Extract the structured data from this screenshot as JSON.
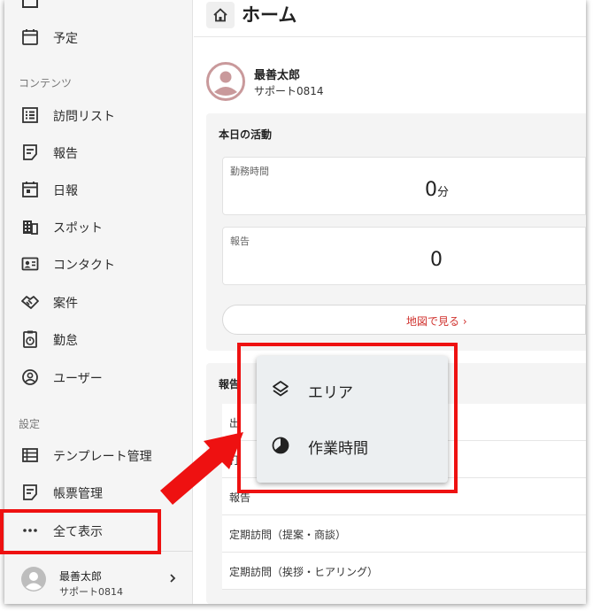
{
  "sidebar": {
    "items_top": [
      {
        "label": "予定",
        "icon": "calendar-icon"
      }
    ],
    "section_contents": "コンテンツ",
    "items_contents": [
      {
        "label": "訪問リスト",
        "icon": "list-icon"
      },
      {
        "label": "報告",
        "icon": "report-icon"
      },
      {
        "label": "日報",
        "icon": "daily-report-icon"
      },
      {
        "label": "スポット",
        "icon": "building-icon"
      },
      {
        "label": "コンタクト",
        "icon": "contact-card-icon"
      },
      {
        "label": "案件",
        "icon": "handshake-icon"
      },
      {
        "label": "勤怠",
        "icon": "timer-icon"
      },
      {
        "label": "ユーザー",
        "icon": "user-circle-icon"
      }
    ],
    "section_settings": "設定",
    "items_settings": [
      {
        "label": "テンプレート管理",
        "icon": "template-icon"
      },
      {
        "label": "帳票管理",
        "icon": "form-icon"
      },
      {
        "label": "全て表示",
        "icon": "more-dots-icon"
      }
    ],
    "user": {
      "name": "最善太郎",
      "role": "サポート0814"
    }
  },
  "header": {
    "title": "ホーム",
    "icon": "home-icon"
  },
  "profile": {
    "name": "最善太郎",
    "role": "サポート0814"
  },
  "activity": {
    "title": "本日の活動",
    "work_time": {
      "caption": "勤務時間",
      "value": "0",
      "unit": "分"
    },
    "reports": {
      "caption": "報告",
      "value": "0"
    },
    "map_button": "地図で見る ›"
  },
  "report_panel": {
    "title": "報告",
    "rows": [
      "出",
      "打",
      "報告",
      "定期訪問（提案・商談）",
      "定期訪問（挨拶・ヒアリング）"
    ]
  },
  "popup": {
    "items": [
      {
        "label": "エリア",
        "icon": "layers-icon"
      },
      {
        "label": "作業時間",
        "icon": "clock-pie-icon"
      }
    ]
  },
  "colors": {
    "highlight": "#ee1111",
    "accent_link": "#d0312d",
    "avatar": "#c9999b"
  }
}
